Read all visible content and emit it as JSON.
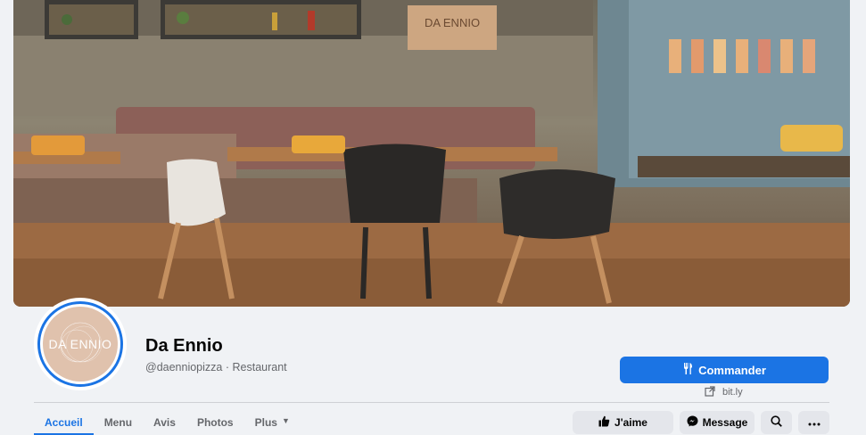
{
  "cover": {
    "alt_semantic": "restaurant-interior-photo",
    "sign_text": "DA ENNIO"
  },
  "profile": {
    "logo_word": "DA ENNIO",
    "name": "Da Ennio",
    "handle": "@daenniopizza",
    "separator": "·",
    "category": "Restaurant"
  },
  "cta": {
    "label": "Commander",
    "icon": "utensils-icon"
  },
  "website": {
    "label": "bit.ly",
    "icon": "external-link-icon"
  },
  "tabs": [
    {
      "label": "Accueil",
      "active": true
    },
    {
      "label": "Menu",
      "active": false
    },
    {
      "label": "Avis",
      "active": false
    },
    {
      "label": "Photos",
      "active": false
    },
    {
      "label": "Plus",
      "active": false,
      "icon": "caret-down-icon"
    }
  ],
  "actions": {
    "like_label": "J'aime",
    "like_icon": "thumbs-up-icon",
    "message_label": "Message",
    "message_icon": "messenger-icon",
    "search_icon": "search-icon",
    "more_icon": "more-dots-icon"
  },
  "colors": {
    "primary": "#1b74e4",
    "background": "#f0f2f5",
    "secondary_text": "#65676b",
    "button_grey": "#e4e6eb",
    "avatar_bg": "#e0c2ad"
  }
}
